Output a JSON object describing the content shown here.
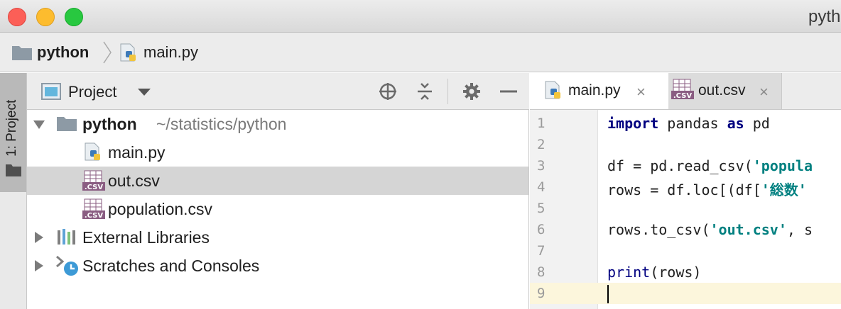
{
  "window": {
    "title": "pyth"
  },
  "navbar": {
    "root": "python",
    "file": "main.py"
  },
  "toolstrip": {
    "project_label": "1: Project"
  },
  "project_panel": {
    "title": "Project",
    "tree": [
      {
        "label": "python",
        "path": "~/statistics/python"
      },
      {
        "label": "main.py"
      },
      {
        "label": "out.csv"
      },
      {
        "label": "population.csv"
      },
      {
        "label": "External Libraries"
      },
      {
        "label": "Scratches and Consoles"
      }
    ]
  },
  "editor": {
    "tabs": [
      {
        "label": "main.py",
        "close": "×"
      },
      {
        "label": "out.csv",
        "close": "×"
      }
    ],
    "line_numbers": [
      "1",
      "2",
      "3",
      "4",
      "5",
      "6",
      "7",
      "8",
      "9"
    ],
    "code": {
      "l1_kw1": "import",
      "l1_mid": " pandas ",
      "l1_kw2": "as",
      "l1_end": " pd",
      "l3_a": "df = pd.read_csv(",
      "l3_str": "'popula",
      "l4_a": "rows = df.loc[(df[",
      "l4_str": "'総数'",
      "l6_a": "rows.to_csv(",
      "l6_str": "'out.csv'",
      "l6_b": ", s",
      "l8_fn": "print",
      "l8_b": "(rows)"
    }
  },
  "colors": {
    "selected_row": "#d5d5d5",
    "current_line": "#fcf6dc",
    "keyword": "#000080",
    "string": "#008080"
  },
  "icons": [
    "folder-icon",
    "python-file-icon",
    "csv-file-icon",
    "libraries-icon",
    "scratches-icon",
    "locate-icon",
    "collapse-icon",
    "gear-icon",
    "minimize-icon"
  ]
}
